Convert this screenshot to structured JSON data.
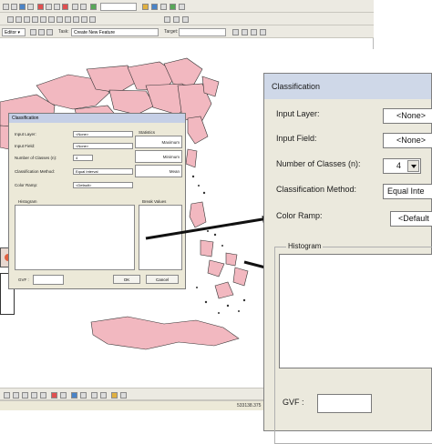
{
  "app": {
    "editor_menu": "Editor ▾",
    "task_label": "Task:",
    "task_value": "Create New Feature",
    "target_label": "Target:",
    "status_coords": "533138.375"
  },
  "small_dialog": {
    "title": "Classification",
    "input_layer_label": "Input Layer:",
    "input_layer_value": "<None>",
    "input_field_label": "Input Field:",
    "input_field_value": "<None>",
    "num_classes_label": "Number of Classes (n):",
    "num_classes_value": "4",
    "method_label": "Classification Method:",
    "method_value": "Equal Interval",
    "color_ramp_label": "Color Ramp:",
    "color_ramp_value": "<Default>",
    "statistics_label": "Statistics",
    "maximum_label": "Maximum",
    "minimum_label": "Minimum",
    "mean_label": "Mean",
    "histogram_label": "Histogram",
    "break_values_label": "Break Values",
    "gvf_label": "GVF :",
    "ok_label": "OK",
    "cancel_label": "Cancel"
  },
  "large_dialog": {
    "title": "Classification",
    "input_layer_label": "Input Layer:",
    "input_layer_value": "<None>",
    "input_field_label": "Input Field:",
    "input_field_value": "<None>",
    "num_classes_label": "Number of Classes (n):",
    "num_classes_value": "4",
    "method_label": "Classification Method:",
    "method_value": "Equal Inte",
    "color_ramp_label": "Color Ramp:",
    "color_ramp_value": "<Default",
    "histogram_label": "Histogram",
    "gvf_label": "GVF :"
  },
  "colors": {
    "map_fill": "#f2b8c0",
    "map_stroke": "#333333",
    "dialog_bg": "#ebe9dd",
    "title_bg": "#cfd8e8"
  }
}
